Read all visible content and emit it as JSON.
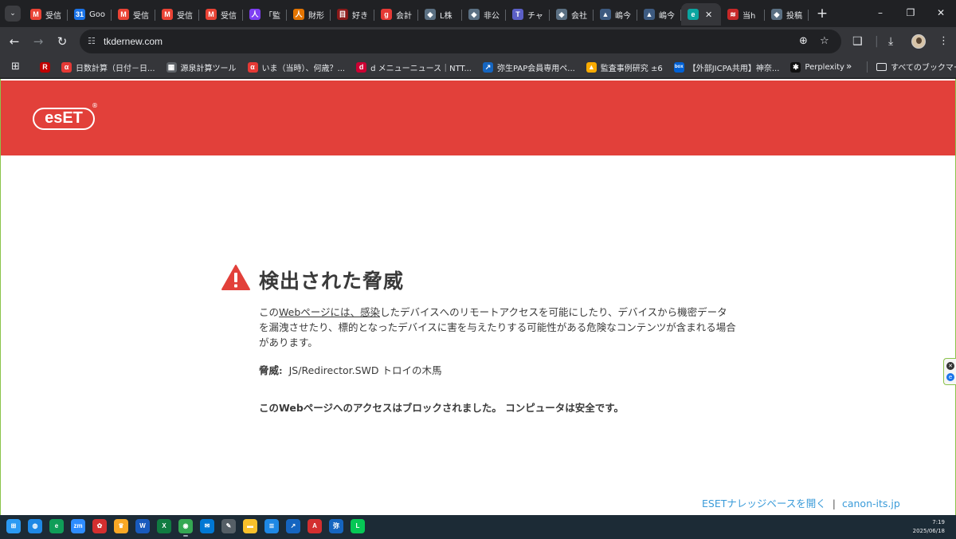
{
  "colors": {
    "brand_red": "#e2403a",
    "link_blue": "#3a9bd9",
    "warning_red": "#e2403a"
  },
  "tabs": [
    {
      "label": "受信",
      "icon": "gmail-icon",
      "color": "#ea4335",
      "glyph": "M"
    },
    {
      "label": "Goo",
      "icon": "google-calendar-icon",
      "color": "#1a73e8",
      "glyph": "31"
    },
    {
      "label": "受信",
      "icon": "gmail-icon",
      "color": "#ea4335",
      "glyph": "M"
    },
    {
      "label": "受信",
      "icon": "gmail-icon",
      "color": "#ea4335",
      "glyph": "M"
    },
    {
      "label": "受信",
      "icon": "gmail-icon",
      "color": "#ea4335",
      "glyph": "M"
    },
    {
      "label": "「監",
      "icon": "contacts-icon",
      "color": "#7e3ff2",
      "glyph": "人"
    },
    {
      "label": "財形",
      "icon": "user-icon",
      "color": "#e37400",
      "glyph": "人"
    },
    {
      "label": "好き",
      "icon": "document-icon",
      "color": "#8b1a1a",
      "glyph": "目"
    },
    {
      "label": "会計",
      "icon": "g-icon",
      "color": "#e53935",
      "glyph": "g"
    },
    {
      "label": "L株",
      "icon": "shield-icon",
      "color": "#5b7083",
      "glyph": "◆"
    },
    {
      "label": "非公",
      "icon": "shield-icon",
      "color": "#5b7083",
      "glyph": "◆"
    },
    {
      "label": "チャ",
      "icon": "teams-icon",
      "color": "#5b5fc7",
      "glyph": "T"
    },
    {
      "label": "会社",
      "icon": "shield-icon",
      "color": "#5b7083",
      "glyph": "◆"
    },
    {
      "label": "嶋今",
      "icon": "bank-icon",
      "color": "#3d5a80",
      "glyph": "▲"
    },
    {
      "label": "嶋今",
      "icon": "bank-icon",
      "color": "#3d5a80",
      "glyph": "▲"
    },
    {
      "label": "",
      "icon": "eset-icon",
      "color": "#0aa5a0",
      "glyph": "e",
      "active": true
    },
    {
      "label": "当h",
      "icon": "flag-icon",
      "color": "#c62828",
      "glyph": "≋"
    },
    {
      "label": "投稿",
      "icon": "shield-icon",
      "color": "#5b7083",
      "glyph": "◆"
    }
  ],
  "address_bar": {
    "url": "tkdernew.com"
  },
  "bookmarks": [
    {
      "label": "",
      "icon": "rakuten-icon",
      "color": "#bf0000",
      "glyph": "R"
    },
    {
      "label": "日数計算（日付－日...",
      "icon": "alpha-icon",
      "color": "#e53935",
      "glyph": "α"
    },
    {
      "label": "源泉計算ツール",
      "icon": "table-icon",
      "color": "#5f6368",
      "glyph": "▦"
    },
    {
      "label": "いま（当時）、何歳？...",
      "icon": "alpha-icon",
      "color": "#e53935",
      "glyph": "α"
    },
    {
      "label": "d メニューニュース｜NTT...",
      "icon": "docomo-icon",
      "color": "#cc0033",
      "glyph": "d"
    },
    {
      "label": "弥生PAP会員専用ペ...",
      "icon": "yayoi-icon",
      "color": "#1565c0",
      "glyph": "↗"
    },
    {
      "label": "監査事例研究 ±6",
      "icon": "image-icon",
      "color": "#f9ab00",
      "glyph": "▲"
    },
    {
      "label": "【外部JICPA共用】神奈...",
      "icon": "box-icon",
      "color": "#0061d5",
      "glyph": "box"
    },
    {
      "label": "Perplexity",
      "icon": "perplexity-icon",
      "color": "#111111",
      "glyph": "✱"
    }
  ],
  "bookmarks_all_label": "すべてのブックマーク",
  "eset": {
    "logo_text": "esET",
    "logo_reg": "®",
    "title": "検出された脅威",
    "desc_pre": "この",
    "desc_link1": "Webページには、感染",
    "desc_post": "したデバイスへのリモートアクセスを可能にしたり、デバイスから機密データを漏洩させたり、標的となったデバイスに害を与えたりする可能性がある危険なコンテンツが含まれる場合があります。",
    "threat_label": "脅威:",
    "threat_name": "JS/Redirector.SWD トロイの木馬",
    "blocked_message": "このWebページへのアクセスはブロックされました。 コンピュータは安全です。",
    "footer_link1": "ESETナレッジベースを開く",
    "footer_sep": "|",
    "footer_link2": "canon-its.jp"
  },
  "taskbar": {
    "icons": [
      {
        "name": "start-icon",
        "color": "#2b9af3",
        "glyph": "⊞"
      },
      {
        "name": "edge-globe-icon",
        "color": "#1e88e5",
        "glyph": "◍"
      },
      {
        "name": "edge-icon",
        "color": "#0f9d58",
        "glyph": "e"
      },
      {
        "name": "zoom-icon",
        "color": "#2d8cff",
        "glyph": "zm"
      },
      {
        "name": "app-red-icon",
        "color": "#d32f2f",
        "glyph": "✿"
      },
      {
        "name": "app-trophy-icon",
        "color": "#f9a825",
        "glyph": "♛"
      },
      {
        "name": "word-icon",
        "color": "#185abd",
        "glyph": "W"
      },
      {
        "name": "excel-icon",
        "color": "#107c41",
        "glyph": "X"
      },
      {
        "name": "chrome-icon",
        "color": "#34a853",
        "glyph": "◉"
      },
      {
        "name": "mail-icon",
        "color": "#0078d4",
        "glyph": "✉"
      },
      {
        "name": "pen-icon",
        "color": "#555f66",
        "glyph": "✎"
      },
      {
        "name": "explorer-icon",
        "color": "#f9c02b",
        "glyph": "▬"
      },
      {
        "name": "app-blue-icon",
        "color": "#1e88e5",
        "glyph": "≣"
      },
      {
        "name": "app-arrow-icon",
        "color": "#1565c0",
        "glyph": "↗"
      },
      {
        "name": "acrobat-icon",
        "color": "#d32f2f",
        "glyph": "A"
      },
      {
        "name": "yayoi-icon",
        "color": "#1565c0",
        "glyph": "弥"
      },
      {
        "name": "line-icon",
        "color": "#06c755",
        "glyph": "L"
      }
    ],
    "time": "7:19",
    "date": "2025/06/18"
  }
}
